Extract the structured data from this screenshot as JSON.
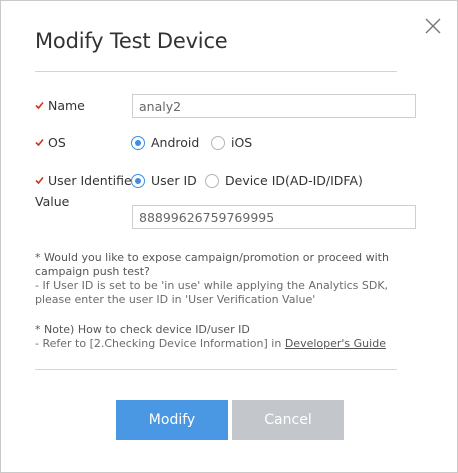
{
  "dialog": {
    "title": "Modify Test Device",
    "close_icon": "close-icon"
  },
  "form": {
    "name": {
      "label": "Name",
      "value": "analy2"
    },
    "os": {
      "label": "OS",
      "options": [
        "Android",
        "iOS"
      ],
      "selected": "Android"
    },
    "identifier": {
      "label": "User Identifier",
      "options": [
        "User ID",
        "Device ID(AD-ID/IDFA)"
      ],
      "selected": "User ID"
    },
    "value": {
      "label": "Value",
      "value": "88899626759769995"
    }
  },
  "notes": {
    "line1": "* Would you like to expose campaign/promotion or proceed with campaign push test?",
    "line2": "- If User ID is set to be 'in use' while applying the Analytics SDK, please enter the user ID in 'User Verification Value'",
    "line3": "* Note) How to check device ID/user ID",
    "line4_prefix": "- Refer to [2.Checking Device Information] in ",
    "line4_link": "Developer's Guide"
  },
  "buttons": {
    "modify": "Modify",
    "cancel": "Cancel"
  },
  "colors": {
    "primary": "#4a97e4",
    "cancel": "#c3c7cc",
    "required_mark": "#d0331e",
    "radio_accent": "#3b8ee8"
  }
}
